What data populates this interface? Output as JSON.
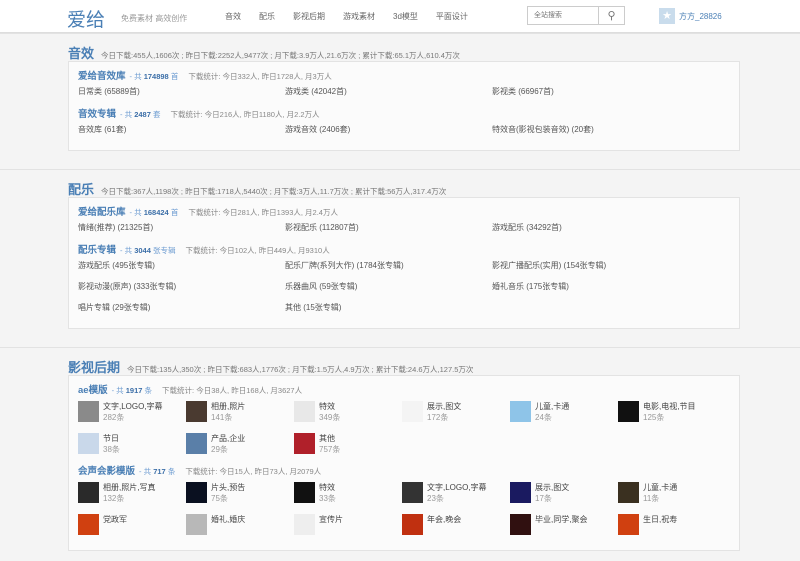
{
  "header": {
    "logo": "爱给",
    "slogan": "免费素材 高效创作",
    "nav": [
      "音效",
      "配乐",
      "影视后期",
      "游戏素材",
      "3d模型",
      "平面设计"
    ],
    "search_placeholder": "全站搜索",
    "username": "方方_28826"
  },
  "sections": [
    {
      "title": "音效",
      "stats": "今日下载:455人,1606次 ; 昨日下载:2252人,9477次 ; 月下载:3.9万人,21.6万次 ; 累计下载:65.1万人,610.4万次",
      "groups": [
        {
          "name": "爱给音效库",
          "count_prefix": "- 共",
          "count": "174898",
          "unit": "首",
          "stats": "下载统计: 今日332人, 昨日1728人, 月3万人",
          "items": [
            "日常类 (65889首)",
            "游戏类 (42042首)",
            "影视类 (66967首)"
          ]
        },
        {
          "name": "音效专辑",
          "count_prefix": "- 共",
          "count": "2487",
          "unit": "套",
          "stats": "下载统计: 今日216人, 昨日1180人, 月2.2万人",
          "items": [
            "音效库 (61套)",
            "游戏音效 (2406套)",
            "特效音(影视包装音效) (20套)"
          ]
        }
      ]
    },
    {
      "title": "配乐",
      "stats": "今日下载:367人,1198次 ; 昨日下载:1718人,5440次 ; 月下载:3万人,11.7万次 ; 累计下载:56万人,317.4万次",
      "groups": [
        {
          "name": "爱给配乐库",
          "count_prefix": "- 共",
          "count": "168424",
          "unit": "首",
          "stats": "下载统计: 今日281人, 昨日1393人, 月2.4万人",
          "items": [
            "情绪(推荐) (21325首)",
            "影视配乐 (112807首)",
            "游戏配乐 (34292首)"
          ]
        },
        {
          "name": "配乐专辑",
          "count_prefix": "- 共",
          "count": "3044",
          "unit": "张专辑",
          "stats": "下载统计: 今日102人, 昨日449人, 月9310人",
          "items": [
            "游戏配乐 (495张专辑)",
            "配乐厂牌(系列大作) (1784张专辑)",
            "影视广播配乐(实用) (154张专辑)",
            "影视动漫(原声) (333张专辑)",
            "乐器曲风 (59张专辑)",
            "婚礼音乐 (175张专辑)",
            "唱片专辑 (29张专辑)",
            "其他 (15张专辑)"
          ]
        }
      ]
    },
    {
      "title": "影视后期",
      "stats": "今日下载:135人,350次 ; 昨日下载:683人,1776次 ; 月下载:1.5万人,4.9万次 ; 累计下载:24.6万人,127.5万次",
      "groups": [
        {
          "name": "ae模版",
          "count_prefix": "- 共",
          "count": "1917",
          "unit": "条",
          "stats": "下载统计: 今日38人, 昨日168人, 月3627人",
          "thumbs": [
            {
              "label": "文字,LOGO,字幕",
              "count": "282条",
              "color": "#8a8a8a"
            },
            {
              "label": "相册,照片",
              "count": "141条",
              "color": "#4a3a30"
            },
            {
              "label": "特效",
              "count": "349条",
              "color": "#e8e8e8"
            },
            {
              "label": "展示,图文",
              "count": "172条",
              "color": "#f4f4f4"
            },
            {
              "label": "儿童,卡通",
              "count": "24条",
              "color": "#8ec4e8"
            },
            {
              "label": "电影,电视,节目",
              "count": "125条",
              "color": "#111111"
            },
            {
              "label": "节日",
              "count": "38条",
              "color": "#c9d8ea"
            },
            {
              "label": "产品,企业",
              "count": "29条",
              "color": "#5a7fa8"
            },
            {
              "label": "其他",
              "count": "757条",
              "color": "#b0202a"
            }
          ]
        },
        {
          "name": "会声会影模版",
          "count_prefix": "- 共",
          "count": "717",
          "unit": "条",
          "stats": "下载统计: 今日15人, 昨日73人, 月2079人",
          "thumbs": [
            {
              "label": "相册,照片,写真",
              "count": "132条",
              "color": "#2a2a2a"
            },
            {
              "label": "片头,预告",
              "count": "75条",
              "color": "#0a1020"
            },
            {
              "label": "特效",
              "count": "33条",
              "color": "#111111"
            },
            {
              "label": "文字,LOGO,字幕",
              "count": "23条",
              "color": "#333333"
            },
            {
              "label": "展示,图文",
              "count": "17条",
              "color": "#1a1a60"
            },
            {
              "label": "儿童,卡通",
              "count": "11条",
              "color": "#3a3020"
            },
            {
              "label": "党政军",
              "count": "",
              "color": "#d04010"
            },
            {
              "label": "婚礼,婚庆",
              "count": "",
              "color": "#b8b8b8"
            },
            {
              "label": "宣传片",
              "count": "",
              "color": "#eeeeee"
            },
            {
              "label": "年会,晚会",
              "count": "",
              "color": "#c03010"
            },
            {
              "label": "毕业,同学,聚会",
              "count": "",
              "color": "#301010"
            },
            {
              "label": "生日,祝寿",
              "count": "",
              "color": "#d04010"
            }
          ]
        }
      ]
    }
  ]
}
